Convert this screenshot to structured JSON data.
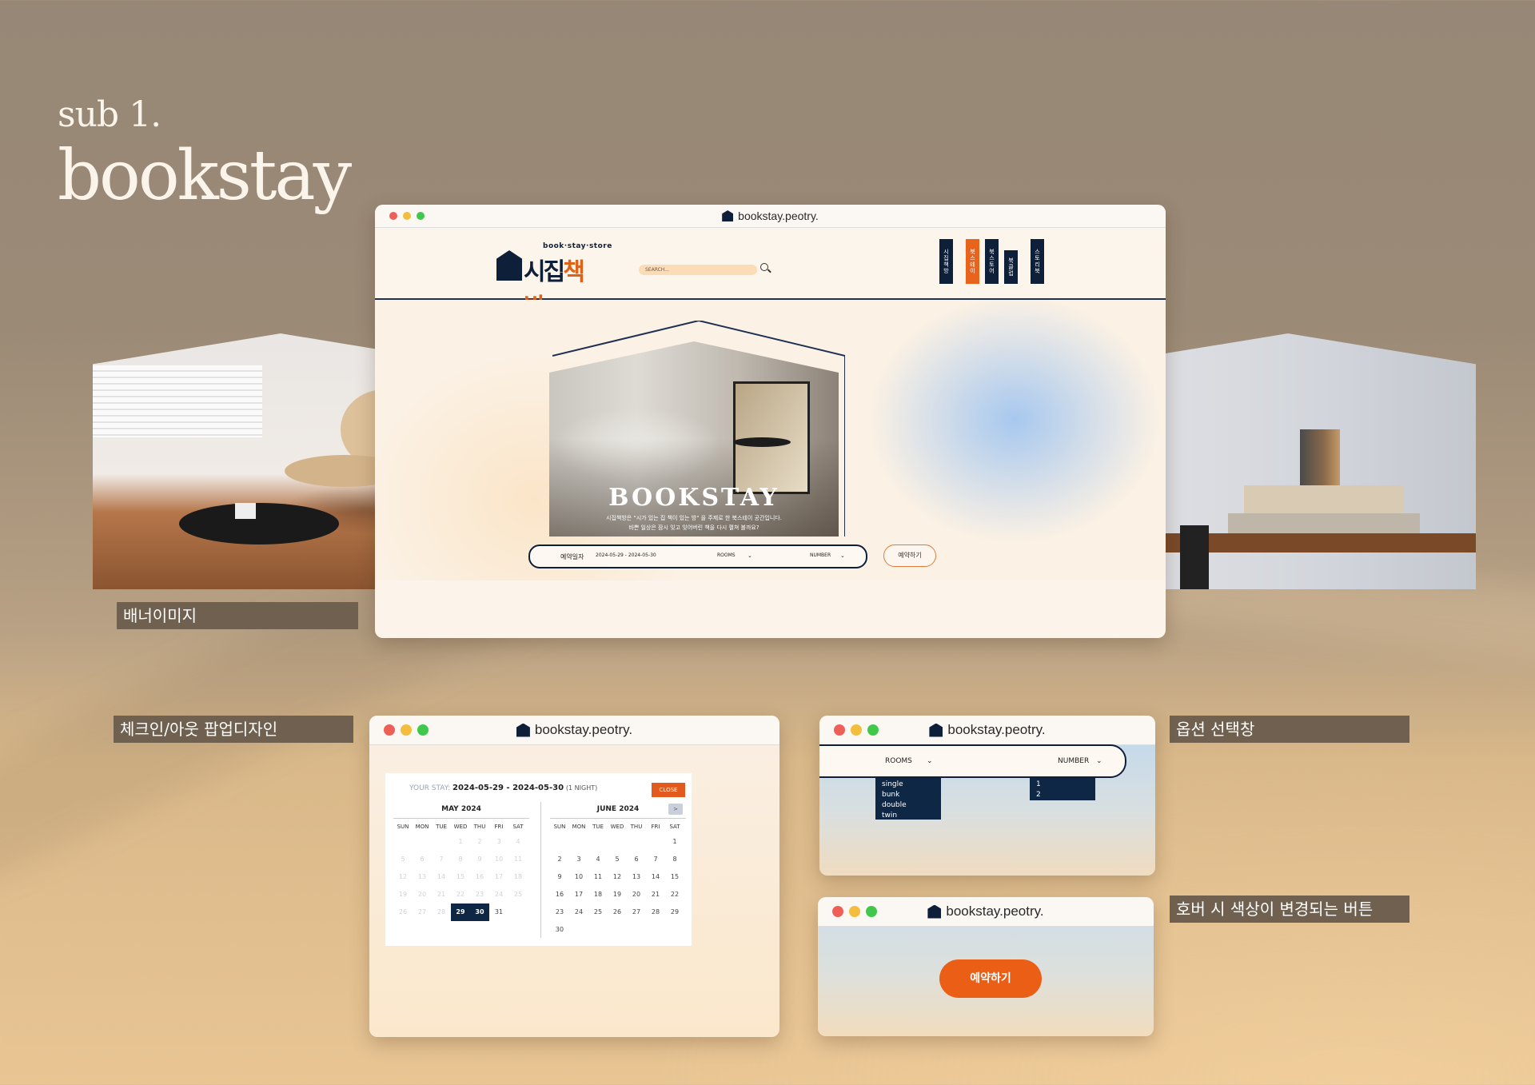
{
  "hero": {
    "sub": "sub 1.",
    "main": "bookstay"
  },
  "browser": {
    "url": "bookstay.peotry."
  },
  "site": {
    "logo_tag": "book·stay·store",
    "logo_a": "시집",
    "logo_b": "책방",
    "search_placeholder": "SEARCH...",
    "nav": [
      "시집책방",
      "북스테이",
      "북스토어",
      "북클럽",
      "스토리북"
    ],
    "hero_word": "BOOKSTAY",
    "hero_desc_1": "시집책방은 \"시가 있는 집 책이 있는 방\" 을 주제로 한 북스테이 공간입니다.",
    "hero_desc_2": "바쁜 일상은 잠시 잊고 잊어버린 책을 다시 펼쳐 볼까요?",
    "booking": {
      "label": "예약일자",
      "dates": "2024-05-29 - 2024-05-30",
      "rooms": "ROOMS",
      "number": "NUMBER"
    },
    "reserve": "예약하기"
  },
  "labels": {
    "banner": "배너이미지",
    "checkin": "체크인/아웃 팝업디자인",
    "option": "옵션 선택창",
    "hover": "호버 시 색상이 변경되는 버튼"
  },
  "calendar": {
    "your_stay": "YOUR STAY:",
    "range": "2024-05-29 - 2024-05-30",
    "nights": "(1 NIGHT)",
    "close": "CLOSE",
    "next": ">",
    "weekdays": [
      "SUN",
      "MON",
      "TUE",
      "WED",
      "THU",
      "FRI",
      "SAT"
    ],
    "months": [
      {
        "name": "MAY 2024",
        "lead": 3,
        "days": 31,
        "dim_until": 28,
        "selected": [
          29,
          30
        ]
      },
      {
        "name": "JUNE 2024",
        "lead": 6,
        "days": 30,
        "dim_until": 0,
        "selected": []
      }
    ]
  },
  "options": {
    "rooms": "ROOMS",
    "number": "NUMBER",
    "room_types": [
      "single",
      "bunk",
      "double",
      "twin"
    ],
    "numbers": [
      "1",
      "2"
    ]
  },
  "hover_button": "예약하기",
  "colors": {
    "navy": "#0e1f3a",
    "orange": "#e8641d",
    "label_bg": "#6f604f"
  }
}
